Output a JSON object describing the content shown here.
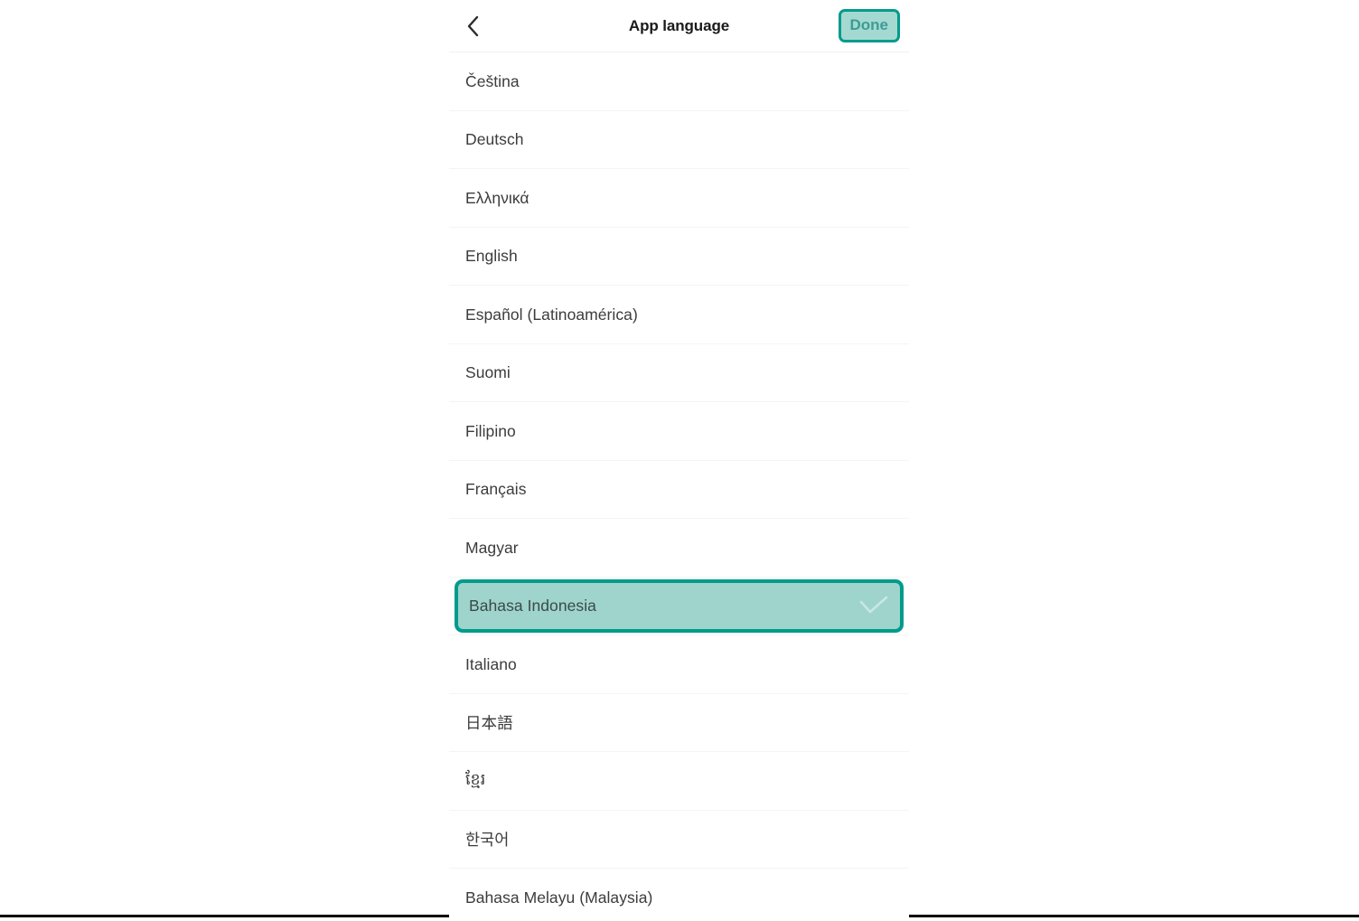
{
  "colors": {
    "accent_teal": "#009b8c",
    "selected_fill": "#9ed4cc",
    "done_fill": "#a4d9d2",
    "done_text": "#3d9c93",
    "row_text": "#3c3c3f",
    "title_text": "#1a1a1a",
    "separator": "#f4f4f5",
    "panel_bg": "#ffffff"
  },
  "header": {
    "back_icon": "chevron-left-icon",
    "title": "App language",
    "done_label": "Done"
  },
  "list": {
    "check_icon": "check-icon",
    "selected_index": 9,
    "items": [
      {
        "label": "Čeština",
        "selected": false
      },
      {
        "label": "Deutsch",
        "selected": false
      },
      {
        "label": "Ελληνικά",
        "selected": false
      },
      {
        "label": "English",
        "selected": false
      },
      {
        "label": "Español (Latinoamérica)",
        "selected": false
      },
      {
        "label": "Suomi",
        "selected": false
      },
      {
        "label": "Filipino",
        "selected": false
      },
      {
        "label": "Français",
        "selected": false
      },
      {
        "label": "Magyar",
        "selected": false
      },
      {
        "label": "Bahasa Indonesia",
        "selected": true
      },
      {
        "label": "Italiano",
        "selected": false
      },
      {
        "label": "日本語",
        "selected": false
      },
      {
        "label": "ខ្មែរ",
        "selected": false
      },
      {
        "label": "한국어",
        "selected": false
      },
      {
        "label": "Bahasa Melayu (Malaysia)",
        "selected": false
      }
    ]
  }
}
